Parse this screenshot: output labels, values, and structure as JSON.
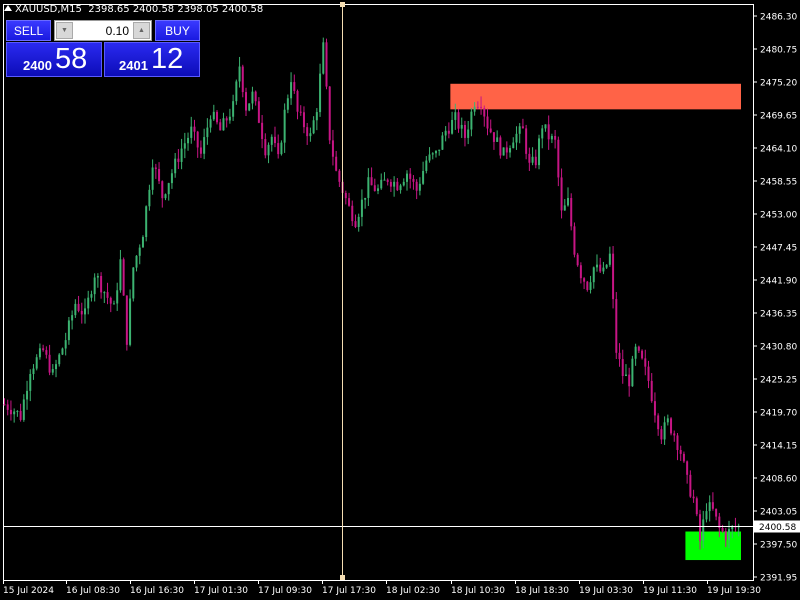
{
  "header": {
    "symbol": "XAUUSD,M15",
    "ohlc": "2398.65 2400.58 2398.05 2400.58"
  },
  "trade_panel": {
    "sell_label": "SELL",
    "buy_label": "BUY",
    "lot_value": "0.10",
    "bid_small": "2400",
    "bid_big": "58",
    "ask_small": "2401",
    "ask_big": "12"
  },
  "price_axis": {
    "labels": [
      "2486.30",
      "2480.75",
      "2475.20",
      "2469.65",
      "2464.10",
      "2458.55",
      "2453.00",
      "2447.45",
      "2441.90",
      "2436.35",
      "2430.80",
      "2425.25",
      "2419.70",
      "2414.15",
      "2408.60",
      "2403.05",
      "2397.50",
      "2391.95"
    ],
    "current_price": "2400.58"
  },
  "time_axis": {
    "labels": [
      "15 Jul 2024",
      "16 Jul 08:30",
      "16 Jul 16:30",
      "17 Jul 01:30",
      "17 Jul 09:30",
      "17 Jul 17:30",
      "18 Jul 02:30",
      "18 Jul 10:30",
      "18 Jul 18:30",
      "19 Jul 03:30",
      "19 Jul 11:30",
      "19 Jul 19:30"
    ]
  },
  "zones": [
    {
      "name": "supply-zone",
      "top_price": 2474.9,
      "bottom_price": 2470.6,
      "start_time": "18 Jul 02:30",
      "color": "#FF6347"
    },
    {
      "name": "demand-zone",
      "top_price": 2399.6,
      "bottom_price": 2394.8,
      "start_time": "19 Jul 11:30",
      "color": "#00FF00"
    }
  ],
  "colors": {
    "bull": "#3CB371",
    "bear": "#C71585",
    "axis": "#FFFFFF",
    "crosshair": "#F5DEB3",
    "current_price_line": "#FFFFFF"
  },
  "chart_data": {
    "type": "candlestick",
    "symbol": "XAUUSD",
    "timeframe": "M15",
    "ylim": [
      2391.95,
      2486.3
    ],
    "anchors": [
      [
        0,
        2421
      ],
      [
        3,
        2420
      ],
      [
        5,
        2419
      ],
      [
        8,
        2427
      ],
      [
        12,
        2430
      ],
      [
        15,
        2426
      ],
      [
        19,
        2432
      ],
      [
        22,
        2438
      ],
      [
        25,
        2436
      ],
      [
        28,
        2443
      ],
      [
        31,
        2440
      ],
      [
        34,
        2437
      ],
      [
        36,
        2445
      ],
      [
        38,
        2432
      ],
      [
        40,
        2444
      ],
      [
        43,
        2450
      ],
      [
        46,
        2462
      ],
      [
        49,
        2456
      ],
      [
        52,
        2460
      ],
      [
        55,
        2464
      ],
      [
        58,
        2467
      ],
      [
        61,
        2463
      ],
      [
        64,
        2470
      ],
      [
        67,
        2467
      ],
      [
        69,
        2469
      ],
      [
        71,
        2471
      ],
      [
        73,
        2478
      ],
      [
        75,
        2471
      ],
      [
        77,
        2473
      ],
      [
        79,
        2469
      ],
      [
        81,
        2464
      ],
      [
        83,
        2466
      ],
      [
        85,
        2462
      ],
      [
        87,
        2470
      ],
      [
        89,
        2476
      ],
      [
        91,
        2470
      ],
      [
        93,
        2468
      ],
      [
        95,
        2466
      ],
      [
        97,
        2471
      ],
      [
        99,
        2481
      ],
      [
        101,
        2466
      ],
      [
        103,
        2460
      ],
      [
        105,
        2457
      ],
      [
        107,
        2454
      ],
      [
        109,
        2452
      ],
      [
        111,
        2455
      ],
      [
        113,
        2458
      ],
      [
        116,
        2457
      ],
      [
        119,
        2459
      ],
      [
        122,
        2458
      ],
      [
        125,
        2460
      ],
      [
        128,
        2457
      ],
      [
        131,
        2462
      ],
      [
        134,
        2463
      ],
      [
        137,
        2467
      ],
      [
        140,
        2469
      ],
      [
        143,
        2466
      ],
      [
        146,
        2472
      ],
      [
        148,
        2472
      ],
      [
        150,
        2468
      ],
      [
        152,
        2466
      ],
      [
        155,
        2463
      ],
      [
        158,
        2466
      ],
      [
        161,
        2467
      ],
      [
        163,
        2461
      ],
      [
        165,
        2462
      ],
      [
        167,
        2468
      ],
      [
        169,
        2466
      ],
      [
        171,
        2465
      ],
      [
        173,
        2453
      ],
      [
        175,
        2455
      ],
      [
        177,
        2447
      ],
      [
        179,
        2443
      ],
      [
        181,
        2441
      ],
      [
        183,
        2444
      ],
      [
        186,
        2443
      ],
      [
        188,
        2446
      ],
      [
        190,
        2430
      ],
      [
        192,
        2426
      ],
      [
        194,
        2425
      ],
      [
        196,
        2430
      ],
      [
        198,
        2428
      ],
      [
        200,
        2425
      ],
      [
        202,
        2420
      ],
      [
        204,
        2416
      ],
      [
        206,
        2418
      ],
      [
        208,
        2416
      ],
      [
        210,
        2413
      ],
      [
        212,
        2408
      ],
      [
        214,
        2405
      ],
      [
        216,
        2398
      ],
      [
        218,
        2404
      ],
      [
        220,
        2403
      ],
      [
        222,
        2400
      ],
      [
        224,
        2399
      ],
      [
        226,
        2400
      ],
      [
        228,
        2400.58
      ]
    ],
    "current_price": 2400.58
  }
}
